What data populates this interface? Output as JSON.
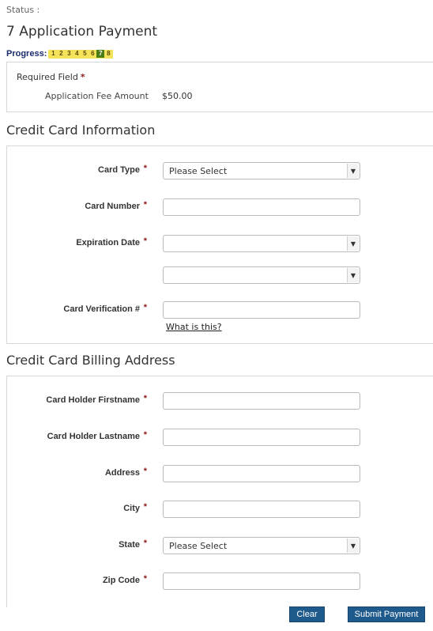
{
  "status_label": "Status :",
  "page_title": "7 Application Payment",
  "progress": {
    "label": "Progress:",
    "steps": [
      "1",
      "2",
      "3",
      "4",
      "5",
      "6",
      "7",
      "8"
    ],
    "current_step": "7"
  },
  "summary": {
    "required_field": "Required Field",
    "fee_label": "Application Fee Amount",
    "fee_value": "$50.00"
  },
  "credit_card": {
    "title": "Credit Card Information",
    "card_type": {
      "label": "Card Type",
      "value": "Please Select"
    },
    "card_number": {
      "label": "Card Number",
      "value": ""
    },
    "expiration": {
      "label": "Expiration Date",
      "month_value": "",
      "year_value": ""
    },
    "cvv": {
      "label": "Card Verification #",
      "value": "",
      "help": "What is this?"
    }
  },
  "billing": {
    "title": "Credit Card Billing Address",
    "firstname": {
      "label": "Card Holder Firstname",
      "value": ""
    },
    "lastname": {
      "label": "Card Holder Lastname",
      "value": ""
    },
    "address": {
      "label": "Address",
      "value": ""
    },
    "city": {
      "label": "City",
      "value": ""
    },
    "state": {
      "label": "State",
      "value": "Please Select"
    },
    "zip": {
      "label": "Zip Code",
      "value": ""
    }
  },
  "buttons": {
    "clear": "Clear",
    "submit": "Submit Payment"
  },
  "required_marker": "*",
  "colors": {
    "accent": "#1f5a8c",
    "required": "#8b1a1a",
    "progress_bg": "#f3e25a",
    "progress_current": "#4a7c18"
  }
}
